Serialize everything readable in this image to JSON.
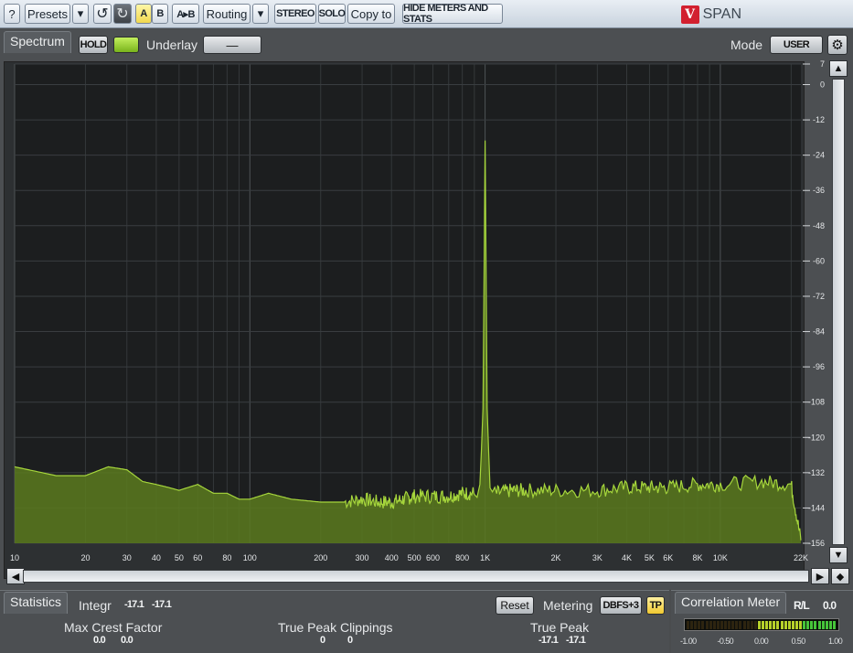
{
  "toolbar": {
    "help": "?",
    "presets": "Presets",
    "presets_dropdown": "▾",
    "undo": "↺",
    "redo": "↻",
    "a": "A",
    "b": "B",
    "a_to_b": "A▸B",
    "routing": "Routing",
    "routing_dropdown": "▾",
    "stereo": "STEREO",
    "solo": "SOLO",
    "copy_to": "Copy to",
    "hide_meters": "HIDE METERS AND STATS",
    "brand_logo": "V",
    "brand_name": "SPAN"
  },
  "spectrum_header": {
    "tab": "Spectrum",
    "hold": "HOLD",
    "underlay_label": "Underlay",
    "underlay_value": "—",
    "mode_label": "Mode",
    "mode_value": "USER",
    "settings_icon": "gear-icon"
  },
  "chart_data": {
    "type": "area",
    "xscale": "log",
    "xlim": [
      10,
      22000
    ],
    "ylim": [
      -156,
      7
    ],
    "x_ticks": [
      "10",
      "20",
      "30",
      "40",
      "50",
      "60",
      "80",
      "100",
      "200",
      "300",
      "400",
      "500",
      "600",
      "800",
      "1K",
      "2K",
      "3K",
      "4K",
      "5K",
      "6K",
      "8K",
      "10K",
      "22K"
    ],
    "x_tick_values": [
      10,
      20,
      30,
      40,
      50,
      60,
      80,
      100,
      200,
      300,
      400,
      500,
      600,
      800,
      1000,
      2000,
      3000,
      4000,
      5000,
      6000,
      8000,
      10000,
      22000
    ],
    "y_ticks": [
      "7",
      "0",
      "-12",
      "-24",
      "-36",
      "-48",
      "-60",
      "-72",
      "-84",
      "-96",
      "-108",
      "-120",
      "-132",
      "-144",
      "-156"
    ],
    "y_tick_values": [
      7,
      0,
      -12,
      -24,
      -36,
      -48,
      -60,
      -72,
      -84,
      -96,
      -108,
      -120,
      -132,
      -144,
      -156
    ],
    "peak": {
      "freq": 1000,
      "db": -19
    },
    "series": [
      {
        "x": [
          10,
          15,
          20,
          25,
          30,
          35,
          40,
          45,
          50,
          60,
          70,
          80,
          90,
          100,
          120,
          150,
          200,
          250,
          300,
          350,
          400,
          450,
          500,
          600,
          700,
          800,
          900,
          950,
          980,
          1000,
          1020,
          1050,
          1100,
          1300,
          1500,
          2000,
          3000,
          4000,
          5000,
          6000,
          8000,
          10000,
          15000,
          20000,
          22000
        ],
        "y": [
          -130,
          -133,
          -133,
          -130,
          -131,
          -135,
          -136,
          -137,
          -138,
          -136,
          -139,
          -139,
          -141,
          -141,
          -139,
          -141,
          -142,
          -142,
          -141,
          -142,
          -142,
          -141,
          -140,
          -140,
          -140,
          -139,
          -139,
          -138,
          -110,
          -19,
          -110,
          -138,
          -139,
          -138,
          -138,
          -138,
          -138,
          -137,
          -137,
          -137,
          -136,
          -136,
          -135,
          -136,
          -155
        ]
      }
    ],
    "fill_color": "#5a7a1e",
    "line_color": "#a6d63c",
    "grid": true
  },
  "statistics": {
    "tab": "Statistics",
    "integr_label": "Integr",
    "integr_l": "-17.1",
    "integr_r": "-17.1",
    "reset": "Reset",
    "metering_label": "Metering",
    "metering_value": "DBFS+3",
    "tp": "TP",
    "max_crest_label": "Max Crest Factor",
    "max_crest_l": "0.0",
    "max_crest_r": "0.0",
    "clippings_label": "True Peak Clippings",
    "clippings_l": "0",
    "clippings_r": "0",
    "true_peak_label": "True Peak",
    "true_peak_l": "-17.1",
    "true_peak_r": "-17.1"
  },
  "correlation": {
    "title": "Correlation Meter",
    "rl_label": "R/L",
    "rl_value": "0.0",
    "level": 0.0,
    "scale": [
      "-1.00",
      "-0.50",
      "0.00",
      "0.50",
      "1.00"
    ]
  }
}
